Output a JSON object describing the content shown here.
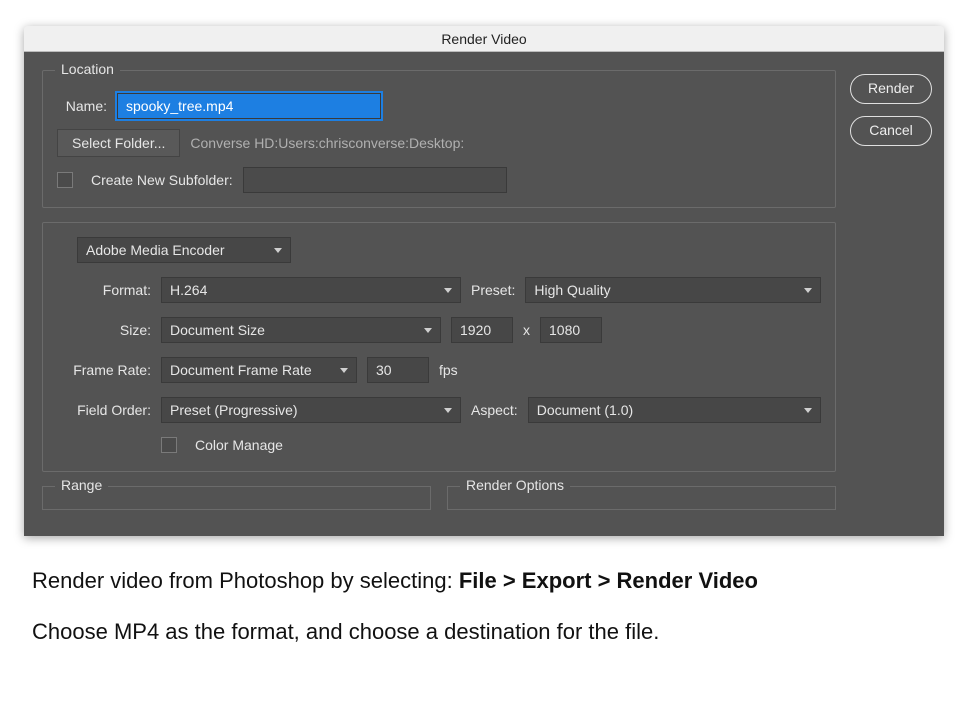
{
  "dialog": {
    "title": "Render Video",
    "location": {
      "legend": "Location",
      "name_label": "Name:",
      "name_value": "spooky_tree.mp4",
      "select_folder_btn": "Select Folder...",
      "path": "Converse HD:Users:chrisconverse:Desktop:",
      "create_subfolder_label": "Create New Subfolder:"
    },
    "settings": {
      "encoder": "Adobe Media Encoder",
      "format_label": "Format:",
      "format_value": "H.264",
      "preset_label": "Preset:",
      "preset_value": "High Quality",
      "size_label": "Size:",
      "size_value": "Document Size",
      "width": "1920",
      "x": "x",
      "height": "1080",
      "framerate_label": "Frame Rate:",
      "framerate_value": "Document Frame Rate",
      "fps": "30",
      "fps_unit": "fps",
      "fieldorder_label": "Field Order:",
      "fieldorder_value": "Preset (Progressive)",
      "aspect_label": "Aspect:",
      "aspect_value": "Document (1.0)",
      "color_manage_label": "Color Manage"
    },
    "range_legend": "Range",
    "render_options_legend": "Render Options",
    "buttons": {
      "render": "Render",
      "cancel": "Cancel"
    }
  },
  "caption": {
    "line1_pre": "Render video from Photoshop by selecting:   ",
    "line1_bold": "File > Export > Render Video",
    "line2": "Choose MP4 as the format, and choose a destination for the file."
  }
}
